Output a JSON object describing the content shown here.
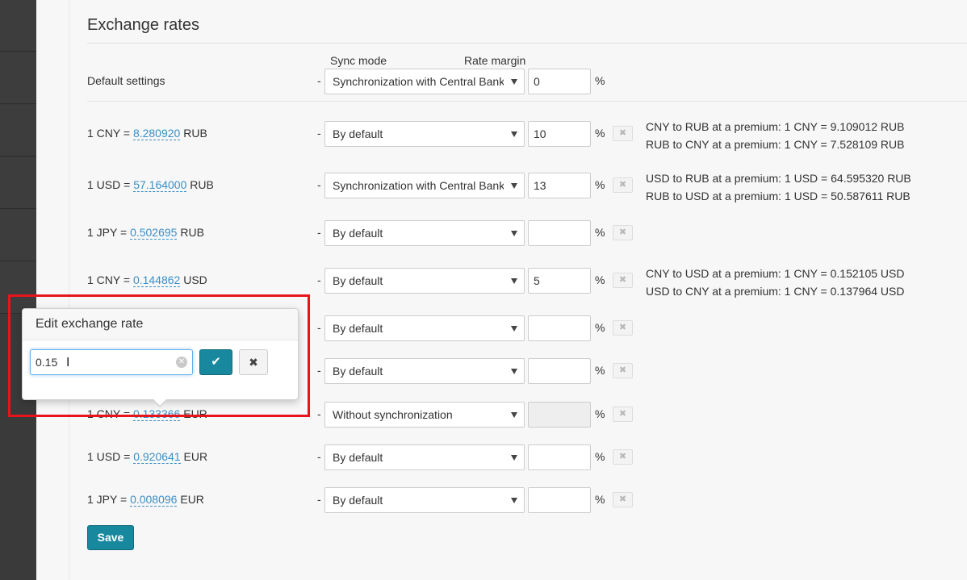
{
  "page": {
    "title": "Exchange rates",
    "headers": {
      "sync_mode": "Sync mode",
      "rate_margin": "Rate margin"
    }
  },
  "default_settings": {
    "label": "Default settings",
    "dash": "-",
    "sync_mode": "Synchronization with Central Bank",
    "margin": "0",
    "pct": "%"
  },
  "rows": [
    {
      "prefix": "1 CNY = ",
      "rate": "8.280920",
      "suffix": " RUB",
      "dash": "-",
      "sync_mode": "By default",
      "margin": "10",
      "pct": "%",
      "clear": "✖",
      "premium_1": "CNY to RUB at a premium: 1 CNY = 9.109012 RUB",
      "premium_2": "RUB to CNY at a premium: 1 CNY = 7.528109 RUB"
    },
    {
      "prefix": "1 USD = ",
      "rate": "57.164000",
      "suffix": " RUB",
      "dash": "-",
      "sync_mode": "Synchronization with Central Bank",
      "margin": "13",
      "pct": "%",
      "clear": "✖",
      "premium_1": "USD to RUB at a premium: 1 USD = 64.595320 RUB",
      "premium_2": "RUB to USD at a premium: 1 USD = 50.587611 RUB"
    },
    {
      "prefix": "1 JPY = ",
      "rate": "0.502695",
      "suffix": " RUB",
      "dash": "-",
      "sync_mode": "By default",
      "margin": "",
      "pct": "%",
      "clear": "✖"
    },
    {
      "prefix": "1 CNY = ",
      "rate": "0.144862",
      "suffix": " USD",
      "dash": "-",
      "sync_mode": "By default",
      "margin": "5",
      "pct": "%",
      "clear": "✖",
      "premium_1": "CNY to USD at a premium: 1 CNY = 0.152105 USD",
      "premium_2": "USD to CNY at a premium: 1 CNY = 0.137964 USD"
    },
    {
      "dash": "-",
      "sync_mode": "By default",
      "margin": "",
      "pct": "%",
      "clear": "✖"
    },
    {
      "dash": "-",
      "sync_mode": "By default",
      "margin": "",
      "pct": "%",
      "clear": "✖"
    },
    {
      "prefix": "1 CNY = ",
      "rate": "0.133366",
      "suffix": " EUR",
      "dash": "-",
      "sync_mode": "Without synchronization",
      "margin": "",
      "pct": "%",
      "clear": "✖"
    },
    {
      "prefix": "1 USD = ",
      "rate": "0.920641",
      "suffix": " EUR",
      "dash": "-",
      "sync_mode": "By default",
      "margin": "",
      "pct": "%",
      "clear": "✖"
    },
    {
      "prefix": "1 JPY = ",
      "rate": "0.008096",
      "suffix": " EUR",
      "dash": "-",
      "sync_mode": "By default",
      "margin": "",
      "pct": "%",
      "clear": "✖"
    }
  ],
  "save_label": "Save",
  "popover": {
    "title": "Edit exchange rate",
    "value": "0.15",
    "cursor": "I",
    "clear_icon": "✕",
    "confirm_icon": "✔",
    "cancel_icon": "✖"
  },
  "icons": [
    "caret-down-icon",
    "clear-icon",
    "check-icon",
    "close-icon",
    "text-cursor-icon"
  ],
  "colors": {
    "accent": "#17889e",
    "link": "#3a8fc7",
    "highlight": "#e8141c",
    "sidebar": "#3a3a3a"
  }
}
